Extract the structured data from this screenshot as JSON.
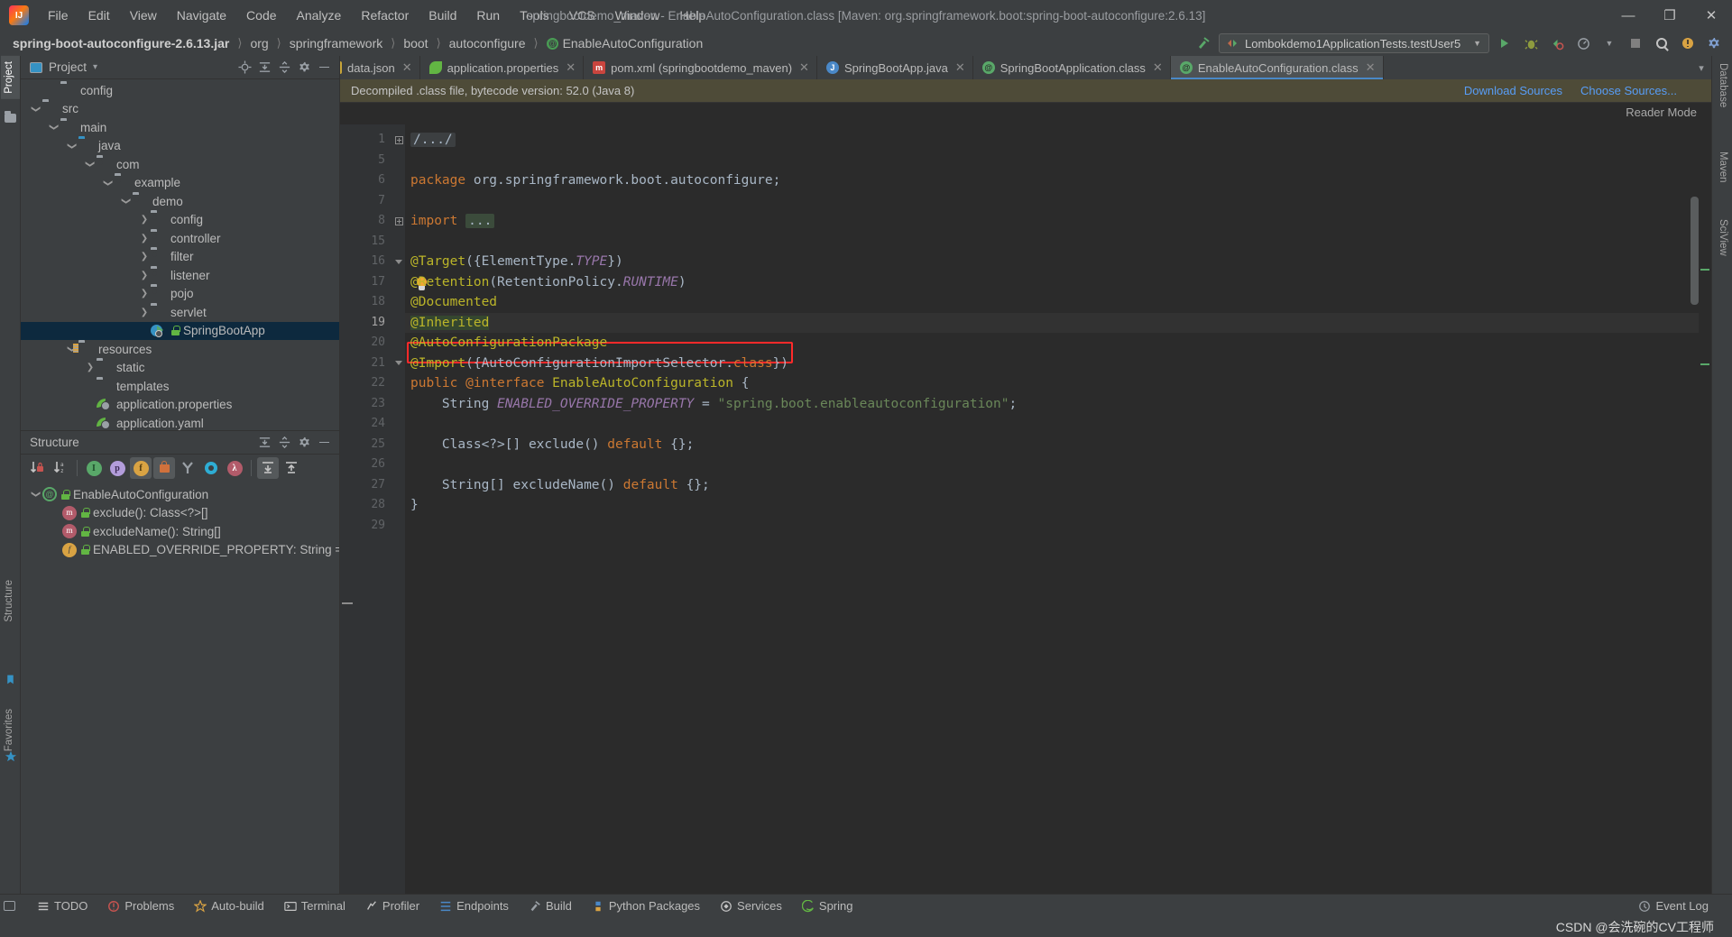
{
  "titlebar": {
    "window_title": "springbootdemo_maven - EnableAutoConfiguration.class [Maven: org.springframework.boot:spring-boot-autoconfigure:2.6.13]",
    "logo_name": "intellij-idea-logo",
    "menu": [
      "File",
      "Edit",
      "View",
      "Navigate",
      "Code",
      "Analyze",
      "Refactor",
      "Build",
      "Run",
      "Tools",
      "VCS",
      "Window",
      "Help"
    ],
    "minimize": "—",
    "maximize": "❐",
    "close": "✕"
  },
  "navbar": {
    "crumbs": [
      "spring-boot-autoconfigure-2.6.13.jar",
      "org",
      "springframework",
      "boot",
      "autoconfigure",
      "EnableAutoConfiguration"
    ],
    "separator": "〉",
    "run_config": "Lombokdemo1ApplicationTests.testUser5",
    "buttons": [
      "run-button",
      "debug-button",
      "run-with-coverage-button",
      "profile-button",
      "stop-button",
      "search-button",
      "settings-button",
      "updates-button"
    ]
  },
  "stripes": {
    "left": [
      "Project",
      "Structure",
      "Favorites"
    ],
    "right": [
      "Database",
      "Maven",
      "SciView"
    ]
  },
  "project_panel": {
    "title": "Project",
    "dropdown": "▾",
    "header_icons": [
      "locate-icon",
      "expand-all-icon",
      "collapse-all-icon",
      "settings-icon",
      "hide-icon"
    ],
    "tree": [
      {
        "label": "config",
        "depth": 2,
        "arrow": "none",
        "icon": "folder"
      },
      {
        "label": "src",
        "depth": 1,
        "arrow": "open",
        "icon": "folder"
      },
      {
        "label": "main",
        "depth": 2,
        "arrow": "open",
        "icon": "folder"
      },
      {
        "label": "java",
        "depth": 3,
        "arrow": "open",
        "icon": "folder-source"
      },
      {
        "label": "com",
        "depth": 4,
        "arrow": "open",
        "icon": "package"
      },
      {
        "label": "example",
        "depth": 5,
        "arrow": "open",
        "icon": "package"
      },
      {
        "label": "demo",
        "depth": 6,
        "arrow": "open",
        "icon": "package"
      },
      {
        "label": "config",
        "depth": 7,
        "arrow": "closed",
        "icon": "package"
      },
      {
        "label": "controller",
        "depth": 7,
        "arrow": "closed",
        "icon": "package"
      },
      {
        "label": "filter",
        "depth": 7,
        "arrow": "closed",
        "icon": "package"
      },
      {
        "label": "listener",
        "depth": 7,
        "arrow": "closed",
        "icon": "package"
      },
      {
        "label": "pojo",
        "depth": 7,
        "arrow": "closed",
        "icon": "package"
      },
      {
        "label": "servlet",
        "depth": 7,
        "arrow": "closed",
        "icon": "package"
      },
      {
        "label": "SpringBootApp",
        "depth": 7,
        "arrow": "none",
        "icon": "spring-boot-app",
        "selected": true
      },
      {
        "label": "resources",
        "depth": 3,
        "arrow": "open",
        "icon": "folder-resources"
      },
      {
        "label": "static",
        "depth": 4,
        "arrow": "closed",
        "icon": "folder"
      },
      {
        "label": "templates",
        "depth": 4,
        "arrow": "none",
        "icon": "folder"
      },
      {
        "label": "application.properties",
        "depth": 4,
        "arrow": "none",
        "icon": "spring-config"
      },
      {
        "label": "application.yaml",
        "depth": 4,
        "arrow": "none",
        "icon": "spring-config"
      }
    ]
  },
  "structure_panel": {
    "title": "Structure",
    "header_icons": [
      "expand-all-icon",
      "collapse-all-icon",
      "settings-icon",
      "hide-icon"
    ],
    "toolbar": [
      {
        "name": "sort-by-visibility-icon",
        "glyph": "↓"
      },
      {
        "name": "sort-alphabetically-icon",
        "glyph": "↓"
      },
      {
        "name": "show-inherited-icon",
        "glyph": "I",
        "color": "#59a869"
      },
      {
        "name": "show-properties-icon",
        "glyph": "p",
        "color": "#b39ddb"
      },
      {
        "name": "show-fields-icon",
        "glyph": "f",
        "color": "#d9a343",
        "pressed": true
      },
      {
        "name": "show-non-public-icon",
        "glyph": "■",
        "color": "#d0713c",
        "pressed": true
      },
      {
        "name": "show-anonymous-icon",
        "glyph": "Y",
        "color": "#9aa0a6"
      },
      {
        "name": "show-interfaces-icon",
        "glyph": "●",
        "color": "#2eadd4"
      },
      {
        "name": "show-lambdas-icon",
        "glyph": "λ",
        "color": "#b25b6a"
      },
      {
        "name": "expand-all-icon",
        "glyph": "⤓",
        "pressed": true
      },
      {
        "name": "collapse-all-icon",
        "glyph": "⤒"
      }
    ],
    "tree": [
      {
        "label": "EnableAutoConfiguration",
        "depth": 0,
        "arrow": "open",
        "icon": "annotation"
      },
      {
        "label": "exclude(): Class<?>[]",
        "depth": 1,
        "arrow": "none",
        "icon": "method"
      },
      {
        "label": "excludeName(): String[]",
        "depth": 1,
        "arrow": "none",
        "icon": "method"
      },
      {
        "label": "ENABLED_OVERRIDE_PROPERTY: String = \"spri",
        "depth": 1,
        "arrow": "none",
        "icon": "field"
      }
    ]
  },
  "editor": {
    "tabs": [
      {
        "label": "data.json",
        "icon": "json",
        "active": false,
        "truncated": true
      },
      {
        "label": "application.properties",
        "icon": "props",
        "active": false
      },
      {
        "label": "pom.xml (springbootdemo_maven)",
        "icon": "maven",
        "active": false
      },
      {
        "label": "SpringBootApp.java",
        "icon": "java",
        "active": false
      },
      {
        "label": "SpringBootApplication.class",
        "icon": "cls",
        "active": false
      },
      {
        "label": "EnableAutoConfiguration.class",
        "icon": "cls",
        "active": true
      }
    ],
    "tab_close": "✕",
    "tab_overflow": "▾",
    "notification": {
      "text": "Decompiled .class file, bytecode version: 52.0 (Java 8)",
      "links": [
        "Download Sources",
        "Choose Sources..."
      ]
    },
    "reader_mode": "Reader Mode",
    "lines": [
      {
        "num": "1",
        "fold": "plus",
        "html": "<span class=\"fold-gray\">/.../</span>"
      },
      {
        "num": "5",
        "fold": "",
        "html": ""
      },
      {
        "num": "6",
        "fold": "",
        "html": "<span class=\"kw\">package</span> org.springframework.boot.autoconfigure;"
      },
      {
        "num": "7",
        "fold": "",
        "html": ""
      },
      {
        "num": "8",
        "fold": "plus",
        "html": "<span class=\"kw\">import</span> <span class=\"fold-inline\">...</span>"
      },
      {
        "num": "15",
        "fold": "",
        "html": ""
      },
      {
        "num": "16",
        "fold": "tri",
        "html": "<span class=\"ann\">@Target</span>({ElementType.<span class=\"ital\">TYPE</span>})"
      },
      {
        "num": "17",
        "fold": "",
        "html": "<span class=\"ann\">@Retention</span>(RetentionPolicy.<span class=\"ital\">RUNTIME</span>)"
      },
      {
        "num": "18",
        "fold": "",
        "html": "<span class=\"ann\">@Documented</span>"
      },
      {
        "num": "19",
        "fold": "",
        "html": "<span class=\"ann green-hl\">@Inherited</span>",
        "highlight": true
      },
      {
        "num": "20",
        "fold": "",
        "html": "<span class=\"ann\">@AutoConfigurationPackage</span>"
      },
      {
        "num": "21",
        "fold": "tri",
        "html": "<span class=\"ann\">@Import</span>({AutoConfigurationImportSelector.<span class=\"kw\">class</span>})"
      },
      {
        "num": "22",
        "fold": "",
        "html": "<span class=\"kw\">public</span> <span class=\"kw\">@interface</span> <span class=\"typename\">EnableAutoConfiguration</span> {"
      },
      {
        "num": "23",
        "fold": "",
        "html": "    String <span class=\"ital\">ENABLED_OVERRIDE_PROPERTY</span> = <span class=\"str\">\"spring.boot.enableautoconfiguration\"</span>;"
      },
      {
        "num": "24",
        "fold": "",
        "html": ""
      },
      {
        "num": "25",
        "fold": "",
        "html": "    Class&lt;?&gt;[] <span class=\"cls2\">exclude</span>() <span class=\"kw\">default</span> {};"
      },
      {
        "num": "26",
        "fold": "",
        "html": ""
      },
      {
        "num": "27",
        "fold": "",
        "html": "    String[] <span class=\"cls2\">excludeName</span>() <span class=\"kw\">default</span> {};"
      },
      {
        "num": "28",
        "fold": "",
        "html": "}"
      },
      {
        "num": "29",
        "fold": "",
        "html": ""
      }
    ],
    "highlight_annotation": "red-box-around-import-line-21"
  },
  "bottombar": {
    "items": [
      {
        "label": "TODO",
        "icon": "todo-icon"
      },
      {
        "label": "Problems",
        "icon": "problems-icon"
      },
      {
        "label": "Auto-build",
        "icon": "auto-build-icon"
      },
      {
        "label": "Terminal",
        "icon": "terminal-icon"
      },
      {
        "label": "Profiler",
        "icon": "profiler-icon"
      },
      {
        "label": "Endpoints",
        "icon": "endpoints-icon"
      },
      {
        "label": "Build",
        "icon": "build-icon"
      },
      {
        "label": "Python Packages",
        "icon": "python-packages-icon"
      },
      {
        "label": "Services",
        "icon": "services-icon"
      },
      {
        "label": "Spring",
        "icon": "spring-icon"
      }
    ],
    "event_log": "Event Log"
  },
  "statusbar": {
    "watermark": "CSDN @会洗碗的CV工程师"
  },
  "colors": {
    "accent": "#4a88c7",
    "selection": "#0d293e",
    "editor_bg": "#2b2b2b",
    "panel_bg": "#3c3f41",
    "annotation": "#bbb529",
    "keyword": "#cc7832",
    "string": "#6a8759",
    "highlight_box": "#ff2a2a"
  }
}
